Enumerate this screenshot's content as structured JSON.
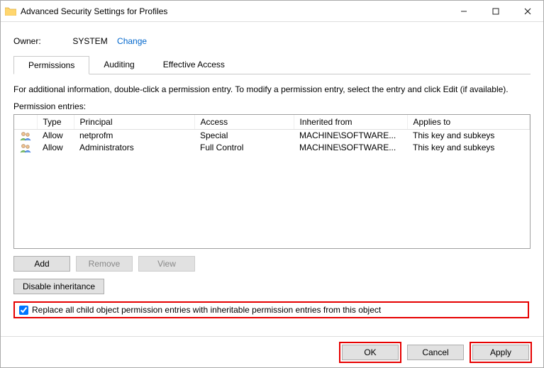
{
  "window": {
    "title": "Advanced Security Settings for Profiles"
  },
  "owner": {
    "label": "Owner:",
    "value": "SYSTEM",
    "change_link": "Change"
  },
  "tabs": [
    {
      "label": "Permissions",
      "active": true
    },
    {
      "label": "Auditing",
      "active": false
    },
    {
      "label": "Effective Access",
      "active": false
    }
  ],
  "info_text": "For additional information, double-click a permission entry. To modify a permission entry, select the entry and click Edit (if available).",
  "entries_label": "Permission entries:",
  "columns": {
    "c0": "",
    "c1": "Type",
    "c2": "Principal",
    "c3": "Access",
    "c4": "Inherited from",
    "c5": "Applies to"
  },
  "entries": [
    {
      "type": "Allow",
      "principal": "netprofm",
      "access": "Special",
      "inherited": "MACHINE\\SOFTWARE...",
      "applies": "This key and subkeys"
    },
    {
      "type": "Allow",
      "principal": "Administrators",
      "access": "Full Control",
      "inherited": "MACHINE\\SOFTWARE...",
      "applies": "This key and subkeys"
    }
  ],
  "buttons": {
    "add": "Add",
    "remove": "Remove",
    "view": "View",
    "disable_inheritance": "Disable inheritance",
    "ok": "OK",
    "cancel": "Cancel",
    "apply": "Apply"
  },
  "checkbox": {
    "label": "Replace all child object permission entries with inheritable permission entries from this object",
    "checked": true
  }
}
